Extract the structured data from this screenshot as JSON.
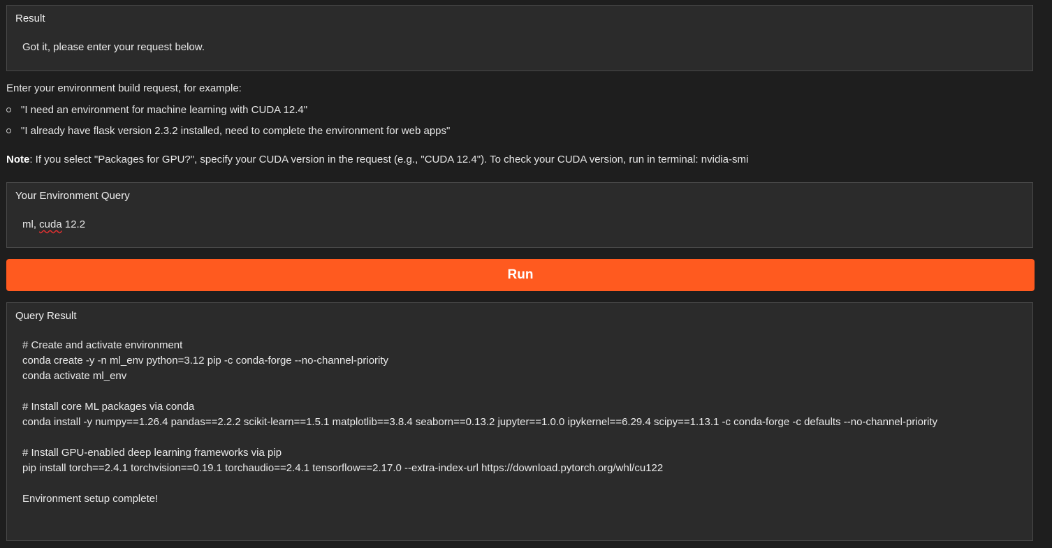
{
  "result_panel": {
    "label": "Result",
    "text": "Got it, please enter your request below."
  },
  "instructions": {
    "intro": "Enter your environment build request, for example:",
    "examples": [
      "\"I need an environment for machine learning with CUDA 12.4\"",
      "\"I already have flask version 2.3.2 installed, need to complete the environment for web apps\""
    ],
    "note_label": "Note",
    "note_text": ": If you select \"Packages for GPU?\", specify your CUDA version in the request (e.g., \"CUDA 12.4\"). To check your CUDA version, run in terminal: nvidia-smi"
  },
  "query_panel": {
    "label": "Your Environment Query",
    "value_prefix": "ml, ",
    "value_misspelled": "cuda",
    "value_suffix": " 12.2"
  },
  "run_button": {
    "label": "Run",
    "color": "#ff5a1f"
  },
  "output_panel": {
    "label": "Query Result",
    "lines": [
      "# Create and activate environment",
      "conda create -y -n ml_env python=3.12 pip -c conda-forge --no-channel-priority",
      "conda activate ml_env",
      "",
      "# Install core ML packages via conda",
      "conda install -y numpy==1.26.4 pandas==2.2.2 scikit-learn==1.5.1 matplotlib==3.8.4 seaborn==0.13.2 jupyter==1.0.0 ipykernel==6.29.4 scipy==1.13.1 -c conda-forge -c defaults --no-channel-priority",
      "",
      "# Install GPU-enabled deep learning frameworks via pip",
      "pip install torch==2.4.1 torchvision==0.19.1 torchaudio==2.4.1 tensorflow==2.17.0 --extra-index-url https://download.pytorch.org/whl/cu122",
      "",
      "Environment setup complete!"
    ]
  }
}
